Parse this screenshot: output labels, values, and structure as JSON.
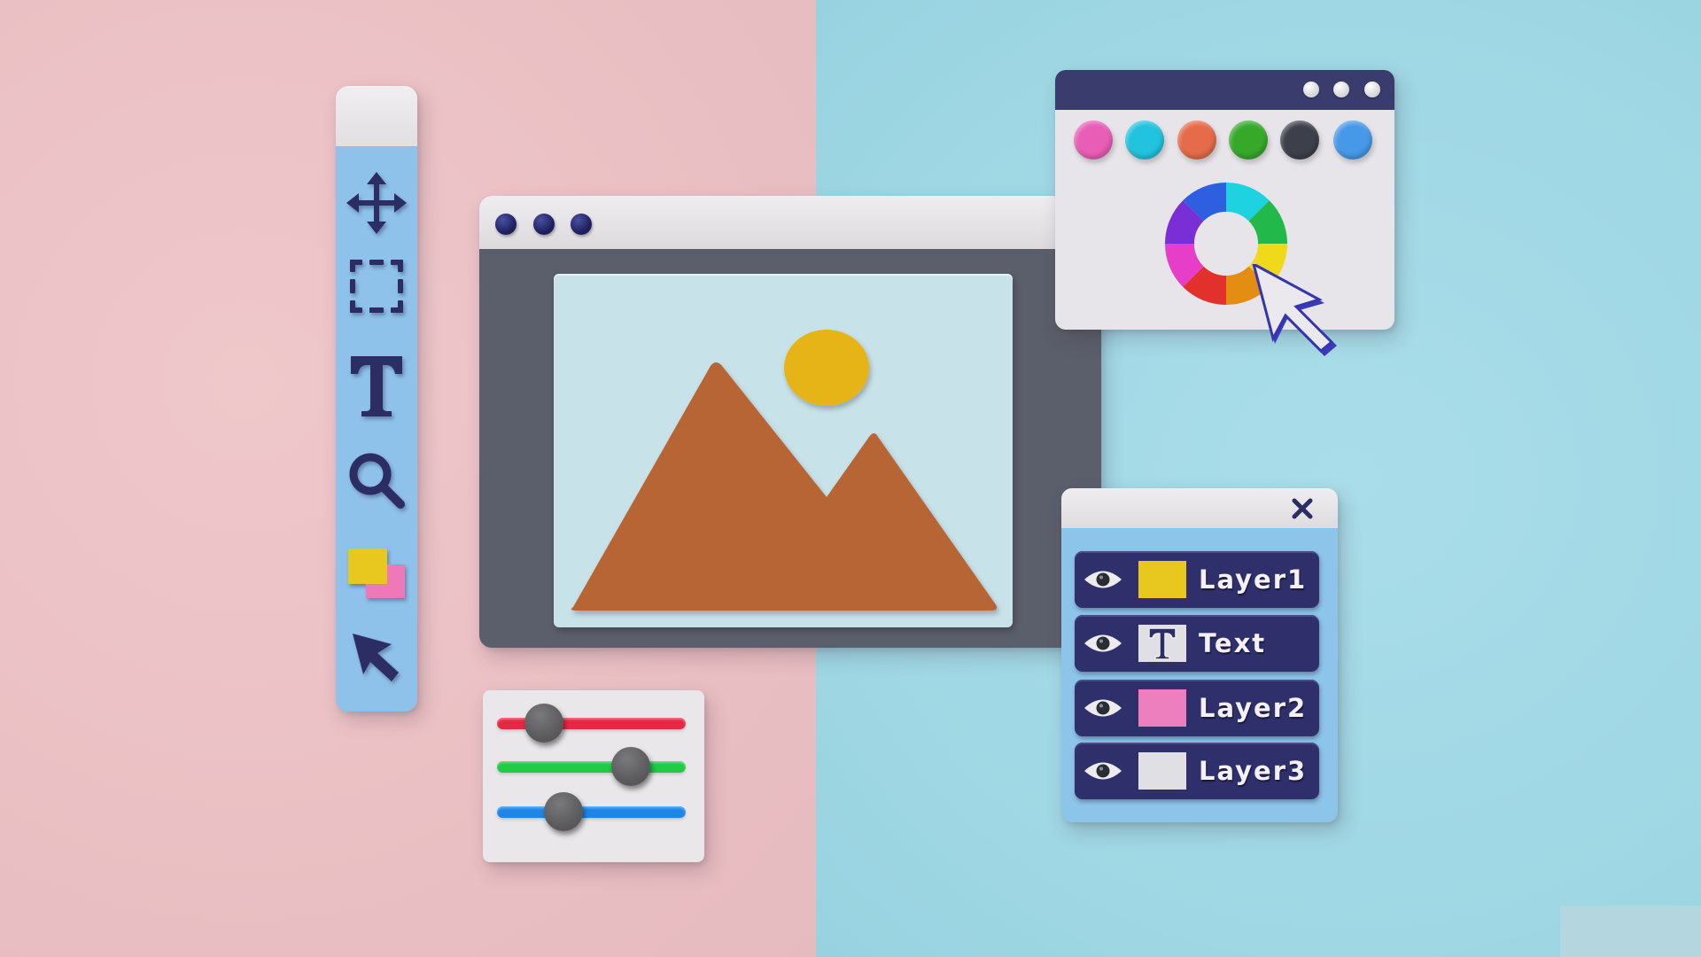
{
  "scene": {
    "background": {
      "left_color": "#e9bfc3",
      "right_color": "#a3d9e6"
    }
  },
  "toolbar": {
    "tools": [
      {
        "name": "move",
        "icon": "move-arrows-icon"
      },
      {
        "name": "marquee-select",
        "icon": "dashed-rectangle-icon"
      },
      {
        "name": "text",
        "icon": "text-t-icon"
      },
      {
        "name": "zoom",
        "icon": "magnifier-icon"
      },
      {
        "name": "color-swap",
        "icon": "color-squares-icon",
        "colors": [
          "#e8c81e",
          "#ee78b8"
        ]
      },
      {
        "name": "pointer",
        "icon": "cursor-arrow-icon"
      }
    ],
    "icon_color": "#2b2d63",
    "body_color": "#8fc2ea"
  },
  "main_window": {
    "title_dots": 3,
    "canvas": {
      "sky_color": "#c8e2ea",
      "mountain_color": "#b86535",
      "sun_color": "#e6b414",
      "content": "mountain-and-sun-image-placeholder"
    }
  },
  "color_picker": {
    "header_color": "#3b3c6e",
    "title_dots": 3,
    "swatches": [
      {
        "name": "pink",
        "color": "#e85db5"
      },
      {
        "name": "cyan",
        "color": "#21c3de"
      },
      {
        "name": "orange",
        "color": "#e56b4a"
      },
      {
        "name": "green",
        "color": "#36a92b"
      },
      {
        "name": "charcoal",
        "color": "#3d3f4b"
      },
      {
        "name": "blue",
        "color": "#4699e8"
      }
    ],
    "wheel_segments": [
      "#1fd2e0",
      "#22b94a",
      "#f0d81a",
      "#e38d12",
      "#e2302c",
      "#e63ec8",
      "#7a2fd6",
      "#2e5fe0"
    ]
  },
  "layers_panel": {
    "close_icon": "close-x-icon",
    "layers": [
      {
        "label": "Layer1",
        "visible": true,
        "thumb_type": "color",
        "thumb_color": "#e8c81e"
      },
      {
        "label": "Text",
        "visible": true,
        "thumb_type": "text",
        "thumb_color": "#e0dfe3"
      },
      {
        "label": "Layer2",
        "visible": true,
        "thumb_type": "color",
        "thumb_color": "#ee7fbf"
      },
      {
        "label": "Layer3",
        "visible": true,
        "thumb_type": "color",
        "thumb_color": "#e0dfe3"
      }
    ]
  },
  "adjustments": {
    "sliders": [
      {
        "name": "red",
        "color": "#e62943",
        "value": 0.25
      },
      {
        "name": "green",
        "color": "#1fcc44",
        "value": 0.71
      },
      {
        "name": "blue",
        "color": "#1f86e8",
        "value": 0.35
      }
    ]
  }
}
